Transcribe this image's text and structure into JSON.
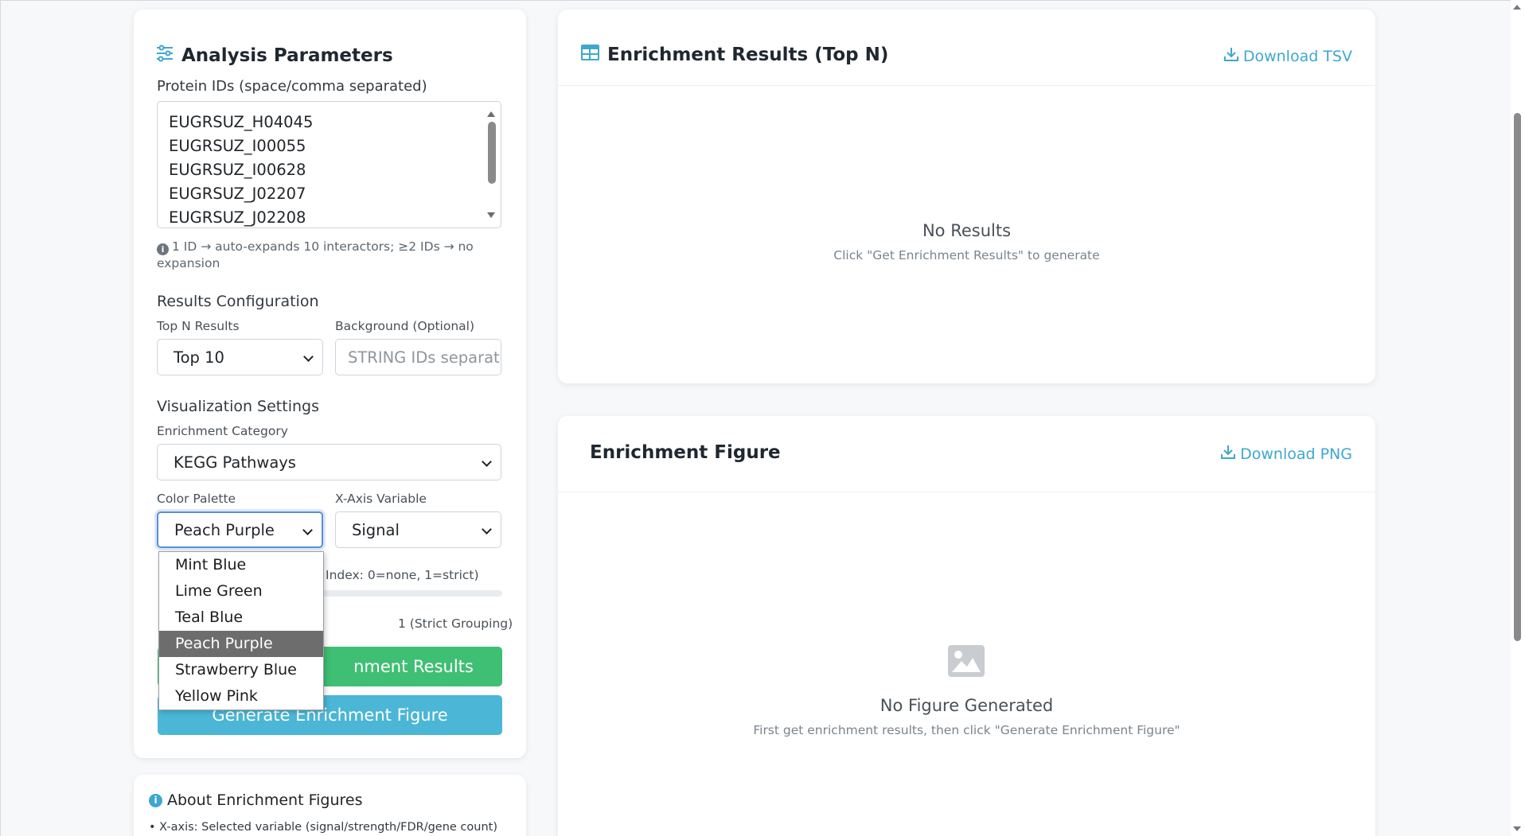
{
  "params": {
    "title": "Analysis Parameters",
    "protein_label": "Protein IDs (space/comma separated)",
    "protein_ids": [
      "EUGRSUZ_H04045",
      "EUGRSUZ_I00055",
      "EUGRSUZ_I00628",
      "EUGRSUZ_J02207",
      "EUGRSUZ_J02208"
    ],
    "hint": "1 ID → auto-expands 10 interactors; ≥2 IDs → no expansion",
    "results_config_title": "Results Configuration",
    "topn_label": "Top N Results",
    "topn_value": "Top 10",
    "background_label": "Background (Optional)",
    "background_placeholder": "STRING IDs separated",
    "viz_title": "Visualization Settings",
    "category_label": "Enrichment Category",
    "category_value": "KEGG Pathways",
    "palette_label": "Color Palette",
    "palette_value": "Peach Purple",
    "xaxis_label": "X-Axis Variable",
    "xaxis_value": "Signal",
    "cluster_hint_partial": "Index: 0=none, 1=strict)",
    "cluster_max_partial": "1 (Strict Grouping)",
    "btn_results_partial": "nment Results",
    "btn_figure": "Generate Enrichment Figure"
  },
  "palette_options": [
    {
      "label": "Mint Blue",
      "selected": false
    },
    {
      "label": "Lime Green",
      "selected": false
    },
    {
      "label": "Teal Blue",
      "selected": false
    },
    {
      "label": "Peach Purple",
      "selected": true
    },
    {
      "label": "Strawberry Blue",
      "selected": false
    },
    {
      "label": "Yellow Pink",
      "selected": false
    }
  ],
  "results": {
    "title": "Enrichment Results (Top N)",
    "download": "Download TSV",
    "empty_title": "No Results",
    "empty_sub": "Click \"Get Enrichment Results\" to generate"
  },
  "figure": {
    "title": "Enrichment Figure",
    "download": "Download PNG",
    "empty_title": "No Figure Generated",
    "empty_sub": "First get enrichment results, then click \"Generate Enrichment Figure\""
  },
  "about": {
    "title": "About Enrichment Figures",
    "line1": "• X-axis: Selected variable (signal/strength/FDR/gene count)"
  },
  "colors": {
    "accent": "#3ea7cf",
    "green": "#3fbf73",
    "blue_btn": "#4bb6d6"
  }
}
